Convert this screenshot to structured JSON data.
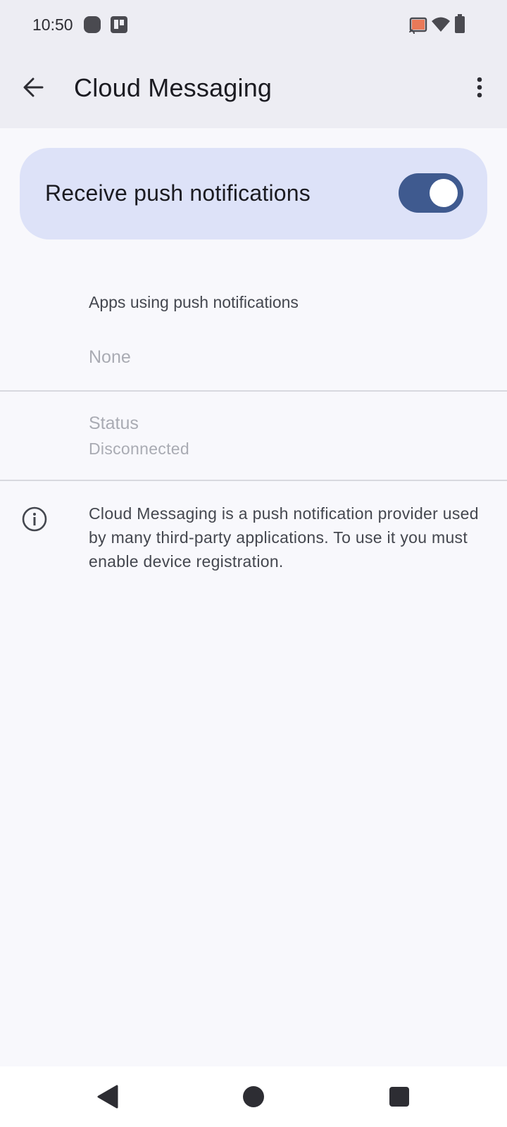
{
  "status_bar": {
    "time": "10:50",
    "left_icons": [
      "app-notification-icon",
      "trello-icon"
    ],
    "right_icons": [
      "cast-icon",
      "wifi-icon",
      "battery-icon"
    ],
    "cast_accent": "#e8643c"
  },
  "app_bar": {
    "title": "Cloud Messaging",
    "back_icon": "arrow-back-icon",
    "menu_icon": "more-vert-icon"
  },
  "push_toggle": {
    "label": "Receive push notifications",
    "enabled": true,
    "track_color": "#3f5a8f",
    "card_color": "#dde2f8"
  },
  "apps_section": {
    "heading": "Apps using push notifications",
    "empty_text": "None"
  },
  "status_section": {
    "title": "Status",
    "value": "Disconnected"
  },
  "info": {
    "icon": "info-icon",
    "text": "Cloud Messaging is a push notification provider used by many third-party applications. To use it you must enable device registration."
  },
  "nav_bar": {
    "buttons": [
      "back-triangle-icon",
      "home-circle-icon",
      "recents-square-icon"
    ]
  }
}
